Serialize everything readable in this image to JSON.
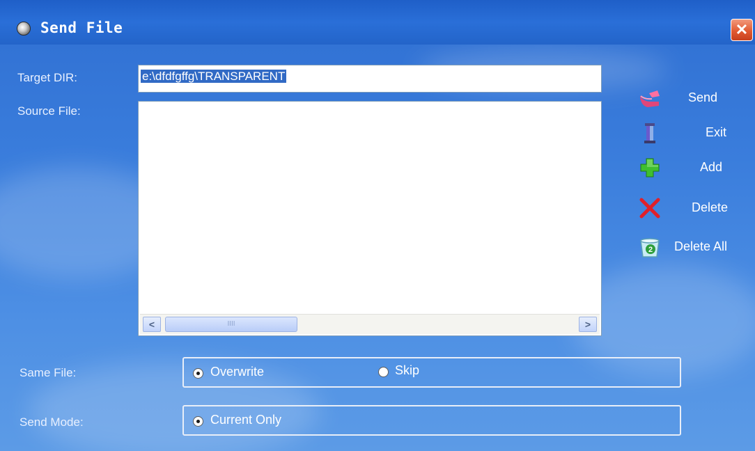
{
  "window": {
    "title": "Send File",
    "close_label": "✕"
  },
  "form": {
    "target_dir_label": "Target DIR:",
    "target_dir_value": "e:\\dfdfgffg\\TRANSPARENT",
    "source_file_label": "Source File:",
    "source_files": [],
    "scroll_left": "<",
    "scroll_right": ">",
    "scroll_grip": "IIII"
  },
  "actions": [
    {
      "label": "Send",
      "icon": "send-icon"
    },
    {
      "label": "Exit",
      "icon": "exit-icon"
    },
    {
      "label": "Add",
      "icon": "add-icon"
    },
    {
      "label": "Delete",
      "icon": "delete-icon"
    },
    {
      "label": "Delete All",
      "icon": "delete-all-icon"
    }
  ],
  "same_file": {
    "label": "Same File:",
    "options": [
      {
        "label": "Overwrite",
        "checked": true
      },
      {
        "label": "Skip",
        "checked": false
      }
    ]
  },
  "send_mode": {
    "label": "Send Mode:",
    "options": [
      {
        "label": "Current Only",
        "checked": true
      }
    ]
  },
  "colors": {
    "title_bar": "#2364c9",
    "background": "#3a7ddc",
    "close_button": "#e15a32",
    "selection": "#316ac5"
  }
}
